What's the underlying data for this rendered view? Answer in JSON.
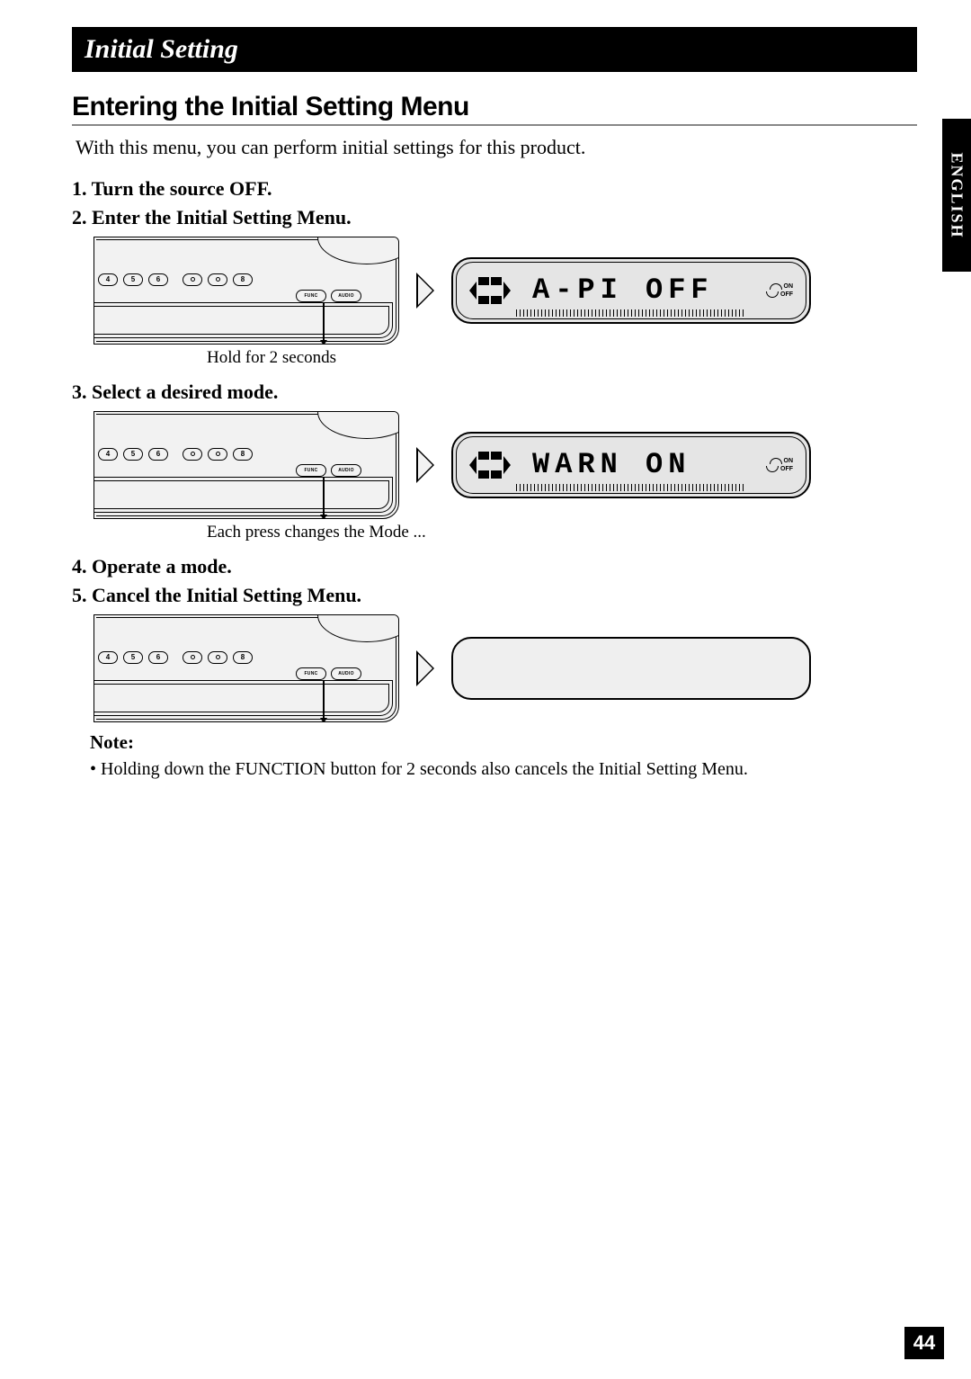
{
  "header": {
    "title": "Initial Setting"
  },
  "side_tab": "ENGLISH",
  "section_heading": "Entering the Initial Setting Menu",
  "intro": "With this menu, you can perform initial settings for this product.",
  "steps": [
    {
      "label": "Turn the source OFF."
    },
    {
      "label": "Enter the Initial Setting Menu.",
      "lcd": "A-PI  OFF",
      "caption": "Hold for 2 seconds"
    },
    {
      "label": "Select a desired mode.",
      "lcd": "WARN  ON",
      "caption": "Each press changes the Mode ..."
    },
    {
      "label": "Operate a mode."
    },
    {
      "label": "Cancel the Initial Setting Menu.",
      "lcd": ""
    }
  ],
  "device": {
    "preset_buttons": [
      "4",
      "5",
      "6"
    ],
    "blank_buttons": 2,
    "right_button": "8",
    "func_button": "FUNC",
    "audio_button": "AUDIO"
  },
  "lcd_indicators": {
    "on": "ON",
    "off": "OFF"
  },
  "note": {
    "heading": "Note:",
    "items": [
      "Holding down the FUNCTION button for 2 seconds also cancels the Initial Setting Menu."
    ]
  },
  "page_number": "44"
}
